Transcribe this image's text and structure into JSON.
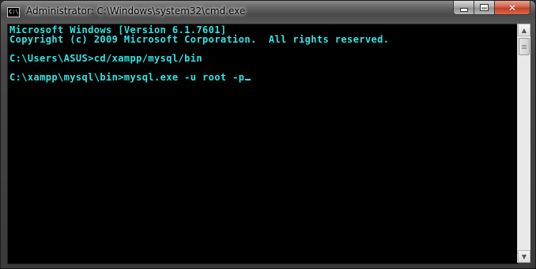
{
  "window": {
    "title": "Administrator: C:\\Windows\\system32\\cmd.exe",
    "app_icon_text": "C:\\",
    "icons": [
      "cmd-app-icon",
      "minimize-icon",
      "maximize-icon",
      "close-icon"
    ]
  },
  "console": {
    "lines": [
      "Microsoft Windows [Version 6.1.7601]",
      "Copyright (c) 2009 Microsoft Corporation.  All rights reserved.",
      "",
      "C:\\Users\\ASUS>cd/xampp/mysql/bin",
      "",
      "C:\\xampp\\mysql\\bin>mysql.exe -u root -p"
    ],
    "text_color": "#2ee6e6",
    "background": "#000000"
  },
  "scrollbar": {
    "up_arrow": "▲",
    "down_arrow": "▼"
  }
}
